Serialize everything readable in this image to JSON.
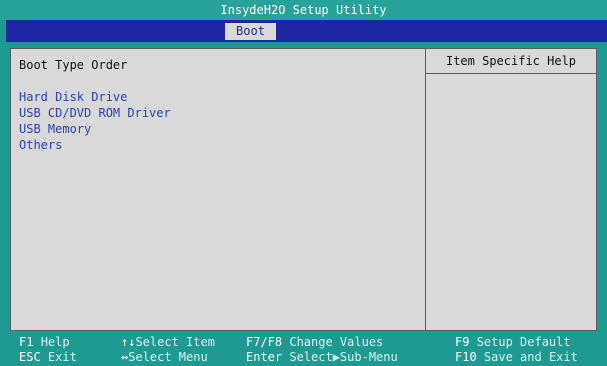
{
  "header": {
    "title": "InsydeH2O Setup Utility"
  },
  "tabs": [
    {
      "label": "Boot"
    }
  ],
  "main": {
    "section_title": "Boot Type Order",
    "boot_items": [
      {
        "label": "Hard Disk Drive"
      },
      {
        "label": "USB CD/DVD ROM Driver"
      },
      {
        "label": "USB Memory"
      },
      {
        "label": "Others"
      }
    ]
  },
  "help": {
    "title": "Item Specific Help"
  },
  "footer": {
    "row1": [
      {
        "key": "F1",
        "desc": "Help"
      },
      {
        "key": "↑↓",
        "desc": "Select Item"
      },
      {
        "key": "F7/F8",
        "desc": "Change Values"
      },
      {
        "key": "F9",
        "desc": "Setup Default"
      }
    ],
    "row2": [
      {
        "key": "ESC",
        "desc": "Exit"
      },
      {
        "key": "↔",
        "desc": "Select Menu"
      },
      {
        "key": "Enter",
        "desc": "Select▶Sub-Menu"
      },
      {
        "key": "F10",
        "desc": "Save and Exit"
      }
    ]
  },
  "colors": {
    "background": "#1f9a93",
    "tabbar": "#1e27a2",
    "panel": "#d9d9d9",
    "boot_item_text": "#2b40b8"
  }
}
